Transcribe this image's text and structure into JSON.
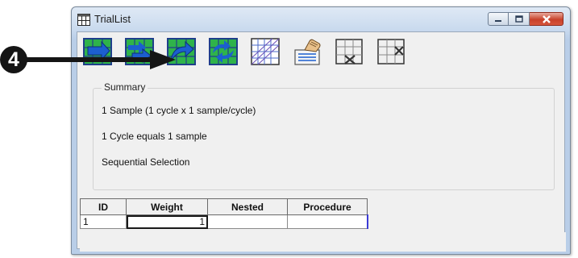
{
  "window": {
    "title": "TrialList"
  },
  "toolbar": {
    "buttons": [
      {
        "name": "add-level-button",
        "icon": "grid-arrow-right-icon"
      },
      {
        "name": "add-multiple-levels-button",
        "icon": "grid-double-arrow-icon"
      },
      {
        "name": "insert-level-button",
        "icon": "grid-curved-arrow-icon"
      },
      {
        "name": "insert-multiple-levels-button",
        "icon": "grid-recycle-arrows-icon"
      },
      {
        "name": "add-attribute-button",
        "icon": "grid-hatched-icon"
      },
      {
        "name": "properties-button",
        "icon": "hand-card-icon"
      },
      {
        "name": "remove-level-button",
        "icon": "grid-x-row-icon"
      },
      {
        "name": "remove-attribute-button",
        "icon": "grid-x-column-icon"
      }
    ]
  },
  "summary": {
    "legend": "Summary",
    "lines": [
      "1 Sample (1 cycle x 1 sample/cycle)",
      "1 Cycle equals 1 sample",
      "Sequential Selection"
    ]
  },
  "grid": {
    "headers": [
      "ID",
      "Weight",
      "Nested",
      "Procedure"
    ],
    "rows": [
      {
        "id": "1",
        "weight": "1",
        "nested": "",
        "procedure": ""
      }
    ]
  },
  "callout": {
    "number": "4"
  },
  "colors": {
    "titlebar": "#c9daee",
    "callout": "#151515",
    "toolbar_green": "#2fb34a",
    "toolbar_blue": "#1c5fcf",
    "close_button": "#c8422b",
    "selection_border": "#3b3bd6"
  }
}
